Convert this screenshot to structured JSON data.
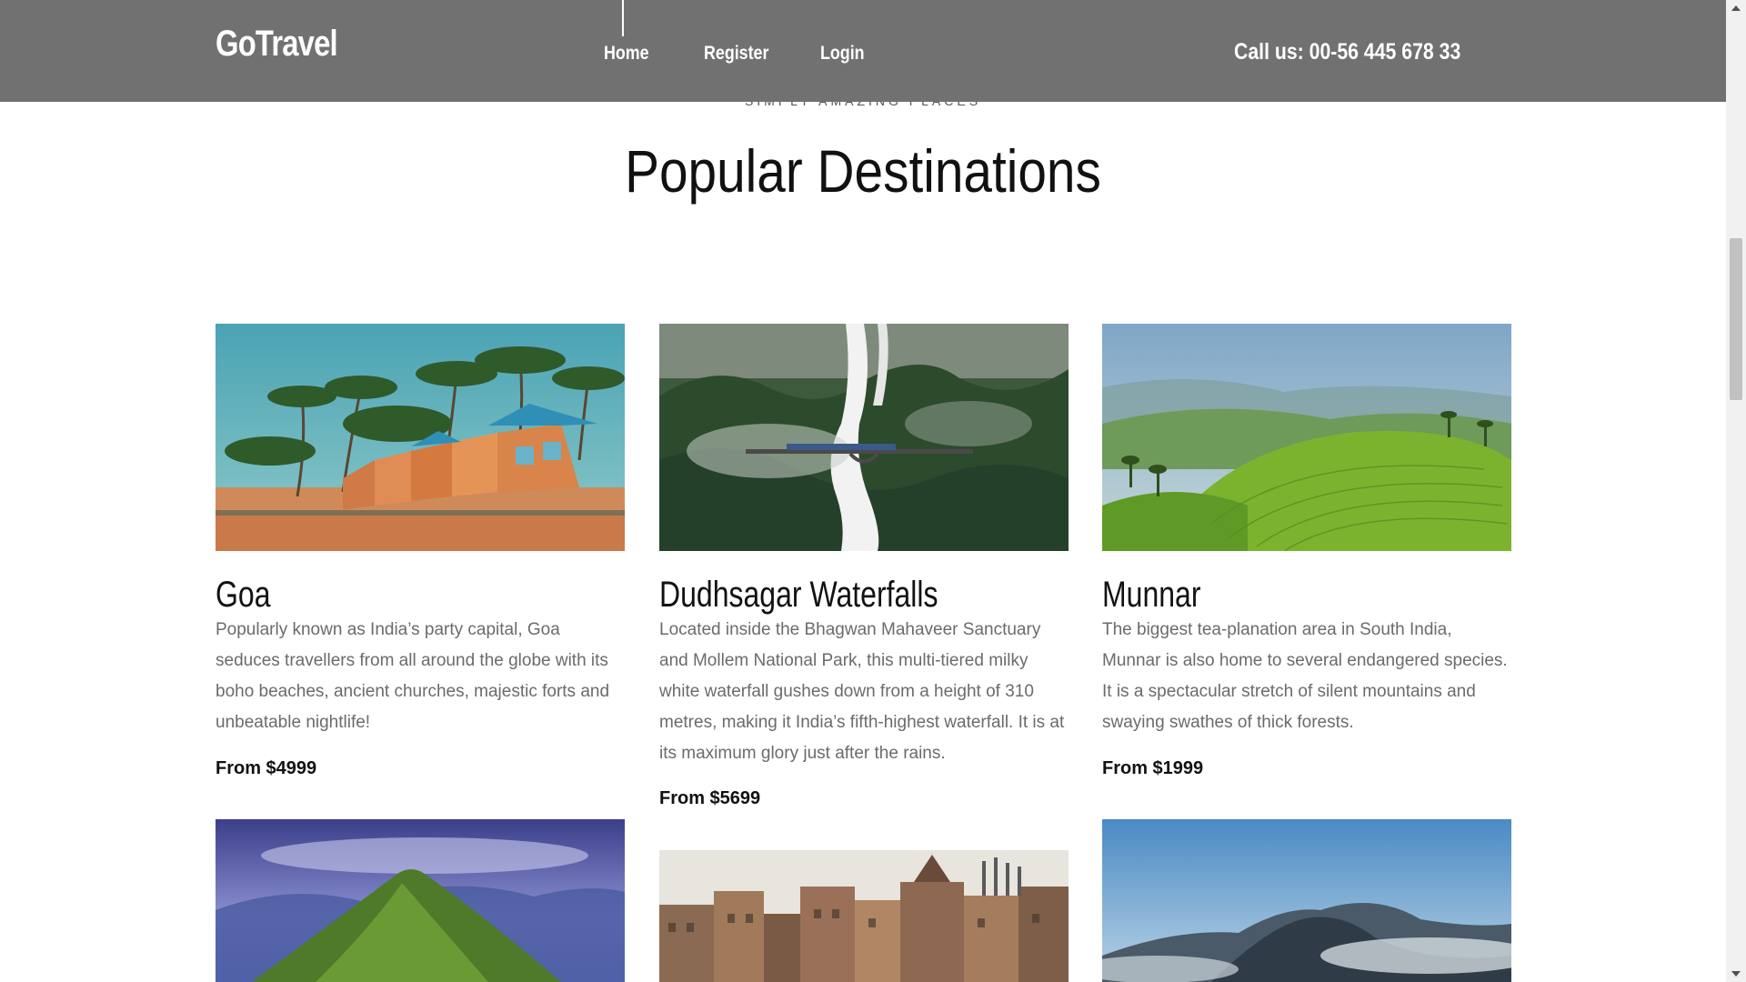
{
  "header": {
    "brand": "GoTravel",
    "nav": [
      {
        "label": "Home"
      },
      {
        "label": "Register"
      },
      {
        "label": "Login"
      }
    ],
    "phone": "Call us: 00-56 445 678 33",
    "background_color": "#717171"
  },
  "section": {
    "eyebrow": "SIMPLY AMAZING PLACES",
    "title": "Popular Destinations"
  },
  "destinations": [
    {
      "name": "Goa",
      "description": "Popularly known as India’s party capital, Goa seduces travellers from all around the globe with its boho beaches, ancient churches, majestic forts and unbeatable nightlife!",
      "price": "From $4999",
      "image": "beach-huts-palms-photo"
    },
    {
      "name": "Dudhsagar Waterfalls",
      "description": "Located inside the Bhagwan Mahaveer Sanctuary and Mollem National Park, this multi-tiered milky white waterfall gushes down from a height of 310 metres, making it India’s fifth-highest waterfall. It is at its maximum glory just after the rains.",
      "price": "From $5699",
      "image": "waterfall-train-bridge-photo"
    },
    {
      "name": "Munnar",
      "description": "The biggest tea-planation area in South India, Munnar is also home to several endangered species. It is a spectacular stretch of silent mountains and swaying swathes of thick forests.",
      "price": "From $1999",
      "image": "tea-plantation-hills-photo"
    },
    {
      "image": "green-hill-peak-photo"
    },
    {
      "image": "riverside-temples-photo"
    },
    {
      "image": "misty-mountains-photo"
    }
  ]
}
